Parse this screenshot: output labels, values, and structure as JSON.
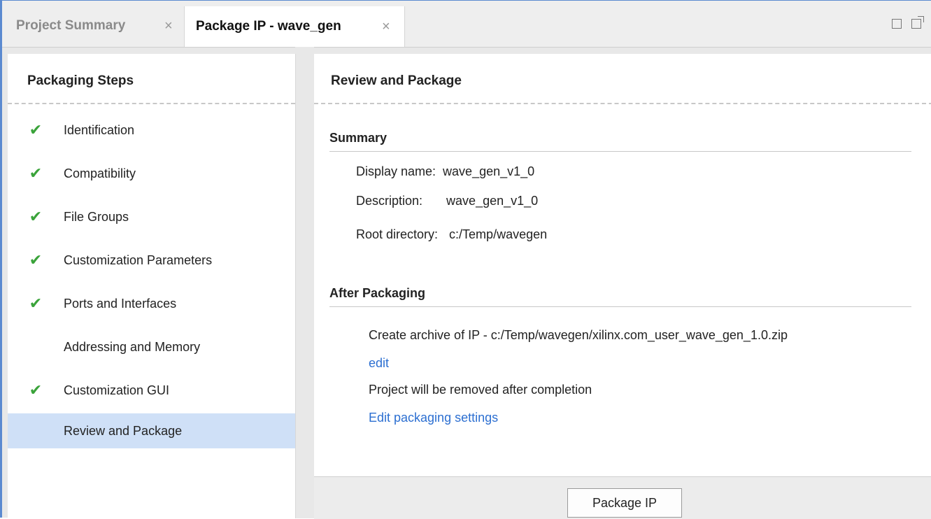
{
  "tabs": [
    {
      "label": "Project Summary",
      "close": "×",
      "active": false
    },
    {
      "label": "Package IP - wave_gen",
      "close": "×",
      "active": true
    }
  ],
  "window_icons": [
    "maximize-icon",
    "restore-icon"
  ],
  "left_panel": {
    "title": "Packaging Steps",
    "steps": [
      {
        "label": "Identification",
        "checked": true,
        "check": "✔"
      },
      {
        "label": "Compatibility",
        "checked": true,
        "check": "✔"
      },
      {
        "label": "File Groups",
        "checked": true,
        "check": "✔"
      },
      {
        "label": "Customization Parameters",
        "checked": true,
        "check": "✔"
      },
      {
        "label": "Ports and Interfaces",
        "checked": true,
        "check": "✔"
      },
      {
        "label": "Addressing and Memory",
        "checked": false,
        "check": ""
      },
      {
        "label": "Customization GUI",
        "checked": true,
        "check": "✔"
      },
      {
        "label": "Review and Package",
        "checked": false,
        "check": "",
        "selected": true
      }
    ]
  },
  "right_panel": {
    "title": "Review and Package",
    "summary": {
      "heading": "Summary",
      "display_name_label": "Display name:",
      "display_name_value": "wave_gen_v1_0",
      "description_label": "Description:",
      "description_value": "wave_gen_v1_0",
      "root_dir_label": "Root directory:",
      "root_dir_value": "c:/Temp/wavegen"
    },
    "after_packaging": {
      "heading": "After Packaging",
      "archive_text": "Create archive of IP - c:/Temp/wavegen/xilinx.com_user_wave_gen_1.0.zip",
      "edit_link": "edit",
      "removed_text": "Project will be removed after completion",
      "settings_link": "Edit packaging settings"
    },
    "package_button": "Package IP"
  },
  "colors": {
    "accent_border": "#5b8ad0",
    "check_green": "#3aa33a",
    "selected_row": "#cfe0f7",
    "link_blue": "#2c6fd1"
  }
}
